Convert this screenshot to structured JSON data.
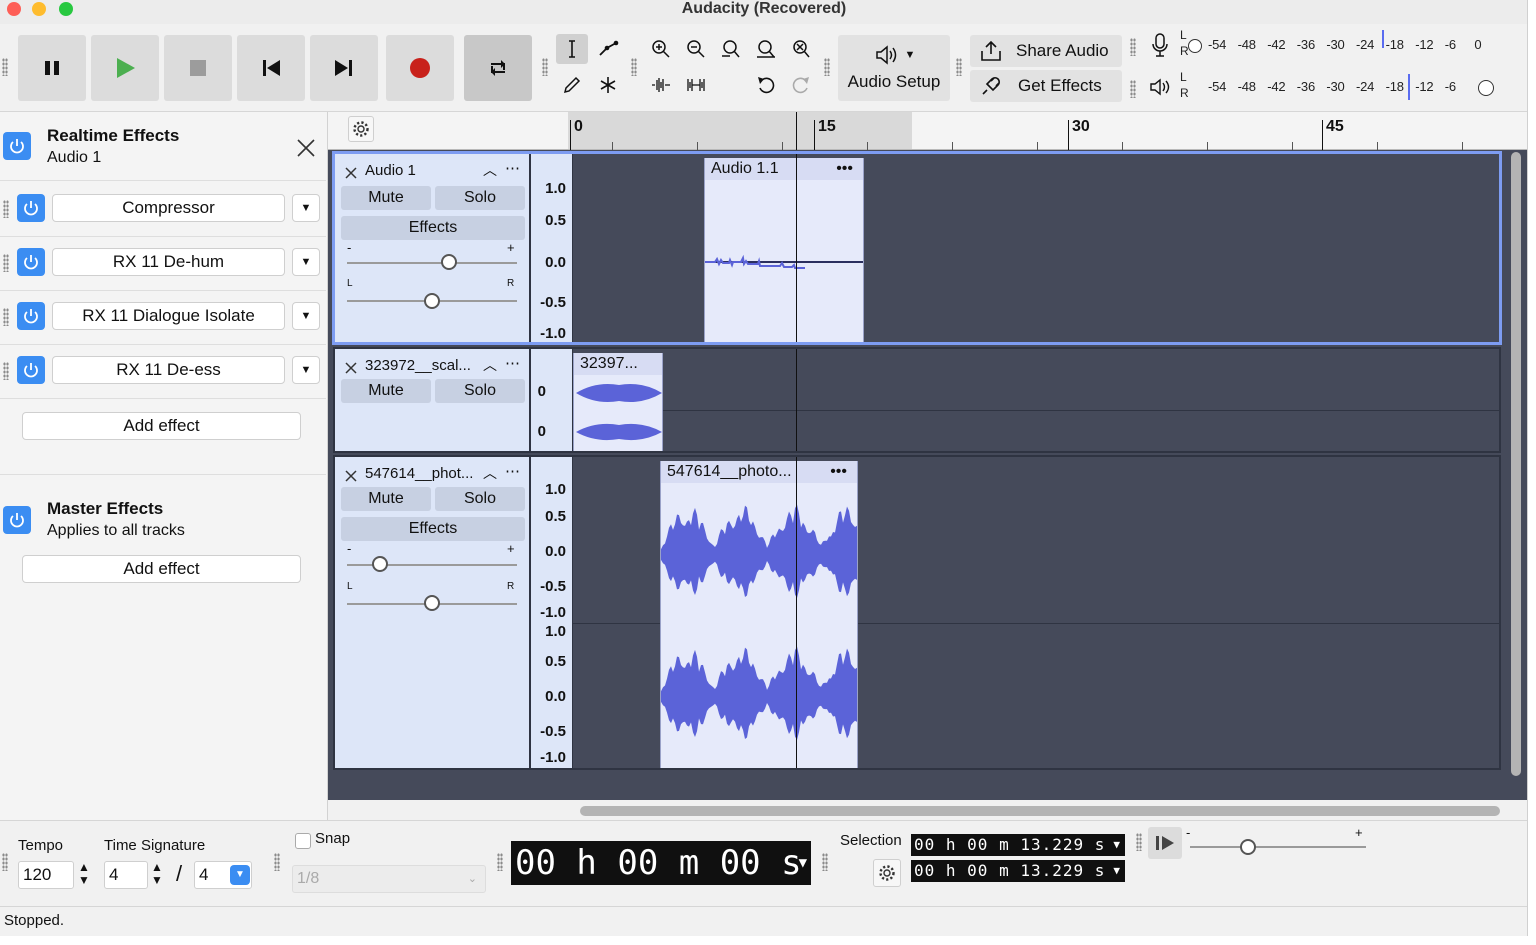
{
  "window": {
    "title": "Audacity (Recovered)"
  },
  "colors": {
    "accent": "#3b8df2",
    "record": "#c8211b",
    "play": "#4caf50",
    "waveform": "#5b63d8",
    "track_bg": "#454a5a",
    "clip_bg": "#e6eafa",
    "selected_outline": "#7d9cf2"
  },
  "toolbar": {
    "transport": [
      "pause-icon",
      "play-icon",
      "stop-icon",
      "skip-start-icon",
      "skip-end-icon",
      "record-icon",
      "loop-icon"
    ],
    "audio_setup_label": "Audio Setup",
    "share_audio_label": "Share Audio",
    "get_effects_label": "Get Effects",
    "meter_rec_channels": [
      "L",
      "R"
    ],
    "meter_play_channels": [
      "L",
      "R"
    ],
    "meter_ticks": [
      "-54",
      "-48",
      "-42",
      "-36",
      "-30",
      "-24",
      "-18",
      "-12",
      "-6",
      "0"
    ],
    "meter_play_ticks": [
      "-54",
      "-48",
      "-42",
      "-36",
      "-30",
      "-24",
      "-18",
      "-12",
      "-6"
    ]
  },
  "realtime": {
    "title": "Realtime Effects",
    "subtitle": "Audio 1",
    "effects": [
      "Compressor",
      "RX 11 De-hum",
      "RX 11 Dialogue Isolate",
      "RX 11 De-ess"
    ],
    "add_effect_label": "Add effect"
  },
  "master": {
    "title": "Master Effects",
    "subtitle": "Applies to all tracks",
    "add_effect_label": "Add effect"
  },
  "ruler": {
    "ticks": [
      "0",
      "15",
      "30",
      "45"
    ]
  },
  "tracks": [
    {
      "name": "Audio 1",
      "mute": "Mute",
      "solo": "Solo",
      "effects": "Effects",
      "gain_minus": "-",
      "gain_plus": "+",
      "pan_l": "L",
      "pan_r": "R",
      "clip": "Audio 1.1",
      "clip_menu": "•••",
      "scale": [
        "1.0",
        "0.5",
        "0.0",
        "-0.5",
        "-1.0"
      ]
    },
    {
      "name": "323972__scal...",
      "mute": "Mute",
      "solo": "Solo",
      "clip": "32397...",
      "scale": [
        "0",
        "0"
      ]
    },
    {
      "name": "547614__phot...",
      "mute": "Mute",
      "solo": "Solo",
      "effects": "Effects",
      "gain_minus": "-",
      "gain_plus": "+",
      "pan_l": "L",
      "pan_r": "R",
      "clip": "547614__photo...",
      "clip_menu": "•••",
      "scale": [
        "1.0",
        "0.5",
        "0.0",
        "-0.5",
        "-1.0",
        "1.0",
        "0.5",
        "0.0",
        "-0.5",
        "-1.0"
      ]
    }
  ],
  "bottom": {
    "tempo_label": "Tempo",
    "tempo_value": "120",
    "time_signature_label": "Time Signature",
    "ts_num": "4",
    "ts_slash": "/",
    "ts_den": "4",
    "snap_label": "Snap",
    "snap_value": "1/8",
    "time_display": "00 h 00 m 00 s",
    "selection_label": "Selection",
    "selection_start": "00 h 00 m 13.229 s",
    "selection_end": "00 h 00 m 13.229 s",
    "speed_minus": "-",
    "speed_plus": "+"
  },
  "status": {
    "text": "Stopped."
  }
}
